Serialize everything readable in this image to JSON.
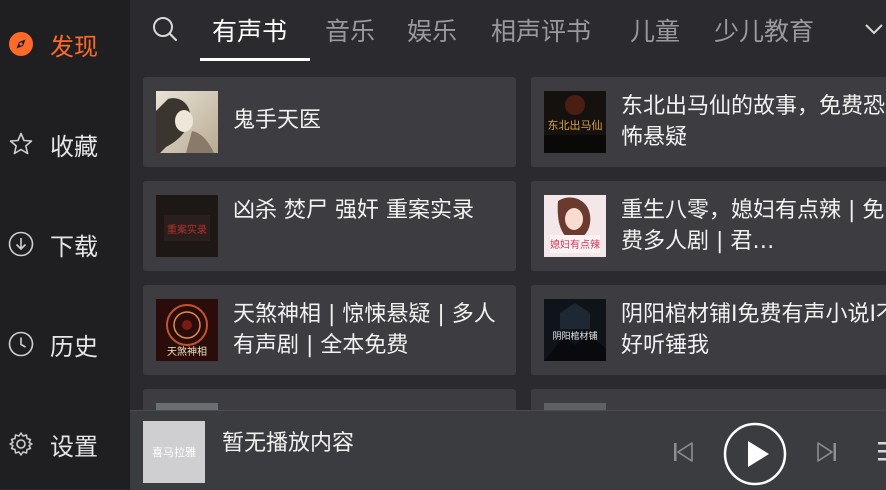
{
  "sidebar": {
    "items": [
      {
        "label": "发现",
        "icon": "compass-icon",
        "active": true
      },
      {
        "label": "收藏",
        "icon": "star-icon",
        "active": false
      },
      {
        "label": "下载",
        "icon": "download-icon",
        "active": false
      },
      {
        "label": "历史",
        "icon": "clock-icon",
        "active": false
      },
      {
        "label": "设置",
        "icon": "gear-icon",
        "active": false
      }
    ]
  },
  "tabs": {
    "items": [
      "有声书",
      "音乐",
      "娱乐",
      "相声评书",
      "儿童",
      "少儿教育"
    ],
    "active": "有声书"
  },
  "books": [
    {
      "title": "鬼手天医"
    },
    {
      "title": "东北出马仙的故事，免费恐怖悬疑",
      "cover_text": "东北出马仙"
    },
    {
      "title": "凶杀 焚尸 强奸 重案实录",
      "cover_text": "重案实录"
    },
    {
      "title": "重生八零，媳妇有点辣 | 免费多人剧 | 君…",
      "cover_text": "媳妇有点辣"
    },
    {
      "title": "天煞神相 | 惊悚悬疑 | 多人有声剧 | 全本免费",
      "cover_text": "天煞神相"
    },
    {
      "title": "阴阳棺材铺I免费有声小说I不好听锤我",
      "cover_text": "阴阳棺材铺"
    }
  ],
  "player": {
    "now_playing": "暂无播放内容",
    "thumb_text": "喜马拉雅"
  },
  "colors": {
    "accent": "#ff6a2b",
    "background": "#2b2b2f",
    "sidebar": "#1f1f22",
    "card": "#3c3c41"
  }
}
